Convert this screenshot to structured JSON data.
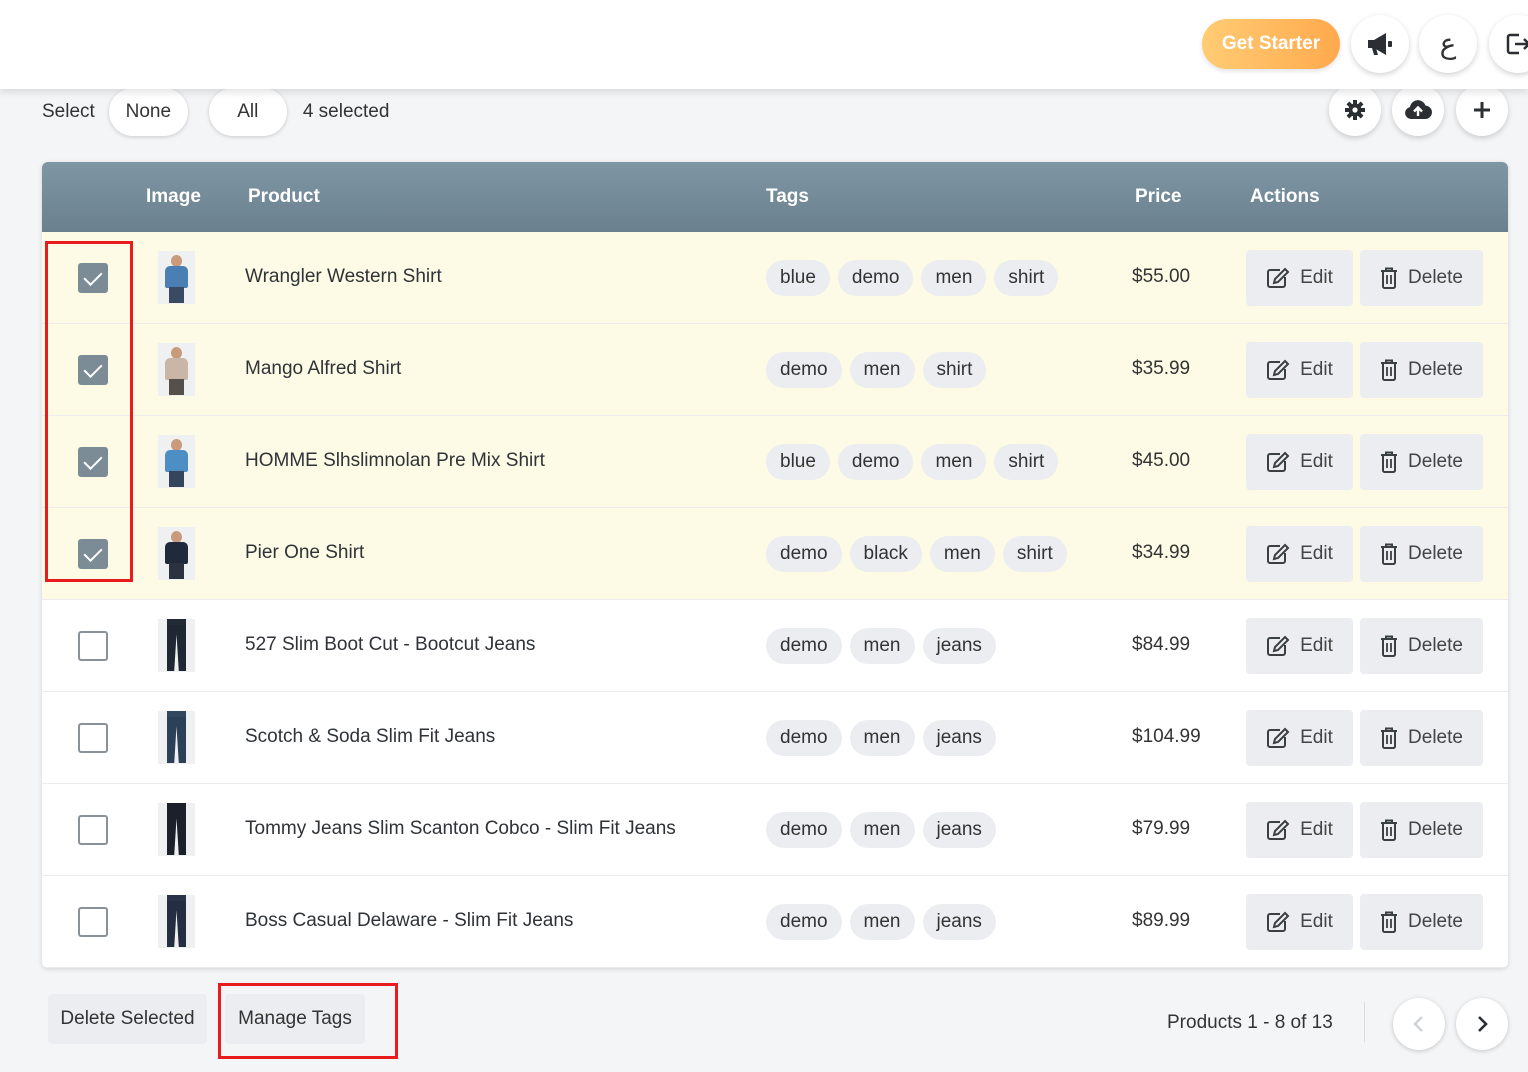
{
  "header": {
    "get_starter_label": "Get Starter",
    "language_glyph": "ع",
    "icons": [
      "megaphone-icon",
      "language-icon",
      "logout-icon"
    ]
  },
  "selection": {
    "label": "Select",
    "none_label": "None",
    "all_label": "All",
    "count_text": "4 selected"
  },
  "toolbar": {
    "icons": [
      "gear-icon",
      "cloud-upload-icon",
      "plus-icon"
    ]
  },
  "table": {
    "columns": {
      "image": "Image",
      "product": "Product",
      "tags": "Tags",
      "price": "Price",
      "actions": "Actions"
    },
    "edit_label": "Edit",
    "delete_label": "Delete",
    "rows": [
      {
        "name": "Wrangler Western Shirt",
        "tags": [
          "blue",
          "demo",
          "men",
          "shirt"
        ],
        "price": "$55.00",
        "selected": true
      },
      {
        "name": "Mango Alfred Shirt",
        "tags": [
          "demo",
          "men",
          "shirt"
        ],
        "price": "$35.99",
        "selected": true
      },
      {
        "name": "HOMME Slhslimnolan Pre Mix Shirt",
        "tags": [
          "blue",
          "demo",
          "men",
          "shirt"
        ],
        "price": "$45.00",
        "selected": true
      },
      {
        "name": "Pier One Shirt",
        "tags": [
          "demo",
          "black",
          "men",
          "shirt"
        ],
        "price": "$34.99",
        "selected": true
      },
      {
        "name": "527 Slim Boot Cut - Bootcut Jeans",
        "tags": [
          "demo",
          "men",
          "jeans"
        ],
        "price": "$84.99",
        "selected": false
      },
      {
        "name": "Scotch & Soda Slim Fit Jeans",
        "tags": [
          "demo",
          "men",
          "jeans"
        ],
        "price": "$104.99",
        "selected": false
      },
      {
        "name": "Tommy Jeans Slim Scanton Cobco - Slim Fit Jeans",
        "tags": [
          "demo",
          "men",
          "jeans"
        ],
        "price": "$79.99",
        "selected": false
      },
      {
        "name": "Boss Casual Delaware - Slim Fit Jeans",
        "tags": [
          "demo",
          "men",
          "jeans"
        ],
        "price": "$89.99",
        "selected": false
      }
    ]
  },
  "footer": {
    "delete_selected_label": "Delete Selected",
    "manage_tags_label": "Manage Tags",
    "pagination_text": "Products 1 - 8 of 13"
  },
  "colors": {
    "accent_orange": "#ffa94d",
    "header_slate": "#7489977",
    "selected_row": "#fdfbe6",
    "highlight_red": "#e81c1c"
  }
}
